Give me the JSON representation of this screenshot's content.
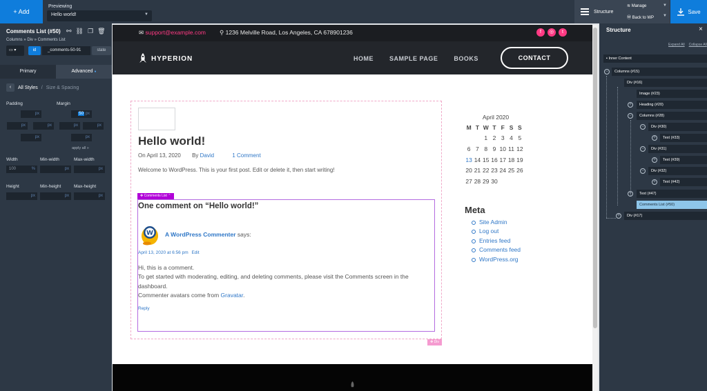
{
  "topbar": {
    "add_label": "+ Add",
    "previewing_label": "Previewing",
    "preview_value": "Hello world!",
    "structure_label": "Structure",
    "manage_label": "Manage",
    "back_label": "Back to WP",
    "save_label": "Save"
  },
  "left_panel": {
    "title": "Comments List (#50)",
    "breadcrumb": "Columns » Div » Comments List",
    "id_tag": "id",
    "id_value": "_comments-50-91",
    "state_label": "state",
    "tab_primary": "Primary",
    "tab_advanced": "Advanced",
    "all_styles": "All Styles",
    "size_spacing": "Size & Spacing",
    "padding_label": "Padding",
    "margin_label": "Margin",
    "apply_all": "apply all »",
    "width_label": "Width",
    "min_width_label": "Min-width",
    "max_width_label": "Max-width",
    "height_label": "Height",
    "min_height_label": "Min-height",
    "max_height_label": "Max-height",
    "margin_top_value": "50",
    "width_value": "100",
    "unit_px": "px",
    "unit_pct": "%"
  },
  "site": {
    "email": "support@example.com",
    "address": "1236 Melville Road, Los Angeles, CA 678901236",
    "logo": "HYPERION",
    "nav": [
      "HOME",
      "SAMPLE PAGE",
      "BOOKS"
    ],
    "contact": "CONTACT"
  },
  "post": {
    "title": "Hello world!",
    "date": "On April 13, 2020",
    "by": "By",
    "author": "David",
    "comments": "1 Comment",
    "body": "Welcome to WordPress. This is your first post. Edit or delete it, then start writing!"
  },
  "comments": {
    "tag": "Comments List",
    "title": "One comment on “Hello world!”",
    "commenter": "A WordPress Commenter",
    "says": "says:",
    "date": "April 13, 2020 at 6:56 pm",
    "edit": "Edit",
    "line1": "Hi, this is a comment.",
    "line2": "To get started with moderating, editing, and deleting comments, please visit the Comments screen in the dashboard.",
    "line3_pre": "Commenter avatars come from",
    "gravatar": "Gravatar",
    "line3_post": ".",
    "reply": "Reply",
    "div_tag": "Div"
  },
  "calendar": {
    "caption": "April 2020",
    "days": [
      "M",
      "T",
      "W",
      "T",
      "F",
      "S",
      "S"
    ],
    "weeks": [
      [
        "",
        "",
        "1",
        "2",
        "3",
        "4",
        "5"
      ],
      [
        "6",
        "7",
        "8",
        "9",
        "10",
        "11",
        "12"
      ],
      [
        "13",
        "14",
        "15",
        "16",
        "17",
        "18",
        "19"
      ],
      [
        "20",
        "21",
        "22",
        "23",
        "24",
        "25",
        "26"
      ],
      [
        "27",
        "28",
        "29",
        "30",
        "",
        "",
        ""
      ]
    ]
  },
  "meta": {
    "title": "Meta",
    "items": [
      "Site Admin",
      "Log out",
      "Entries feed",
      "Comments feed",
      "WordPress.org"
    ]
  },
  "structure": {
    "title": "Structure",
    "close": "×",
    "expand": "Expand All",
    "collapse": "Collapse All",
    "nodes": [
      "Inner Content",
      "Columns (#15)",
      "Div (#16)",
      "Image (#23)",
      "Heading (#20)",
      "Columns (#28)",
      "Div (#30)",
      "Text (#33)",
      "Div (#31)",
      "Text (#39)",
      "Div (#32)",
      "Text (#42)",
      "Text (#47)",
      "Comments List (#50)",
      "Div (#17)"
    ]
  },
  "colors": {
    "accent": "#0f7ddc",
    "panel": "#2d3845",
    "pink": "#ff3a83",
    "link": "#2f77c7",
    "purple": "#b100d8"
  }
}
